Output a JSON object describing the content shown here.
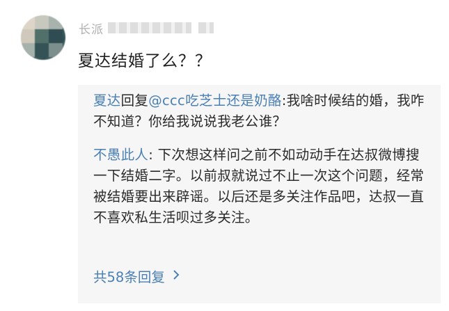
{
  "comment": {
    "username_visible": "长派",
    "text": "夏达结婚了么？？"
  },
  "replies": [
    {
      "author": "夏达",
      "reply_word": "回复",
      "mention": "@ccc吃芝士还是奶酪",
      "separator": ":",
      "text": "我啥时候结的婚，我咋不知道？你给我说说我老公谁？"
    },
    {
      "author": "不愚此人",
      "separator": ": ",
      "text": "下次想这样问之前不如动动手在达叔微博搜一下结婚二字。以前叔就说过不止一次这个问题，经常被结婚要出来辟谣。以后还是多关注作品吧，达叔一直不喜欢私生活呗过多关注。"
    }
  ],
  "more_replies": {
    "label": "共58条回复",
    "icon": "chevron-right-icon"
  },
  "colors": {
    "link": "#4a7fb5",
    "text": "#2b2b2b",
    "reply_bg": "#f6f6f6"
  }
}
